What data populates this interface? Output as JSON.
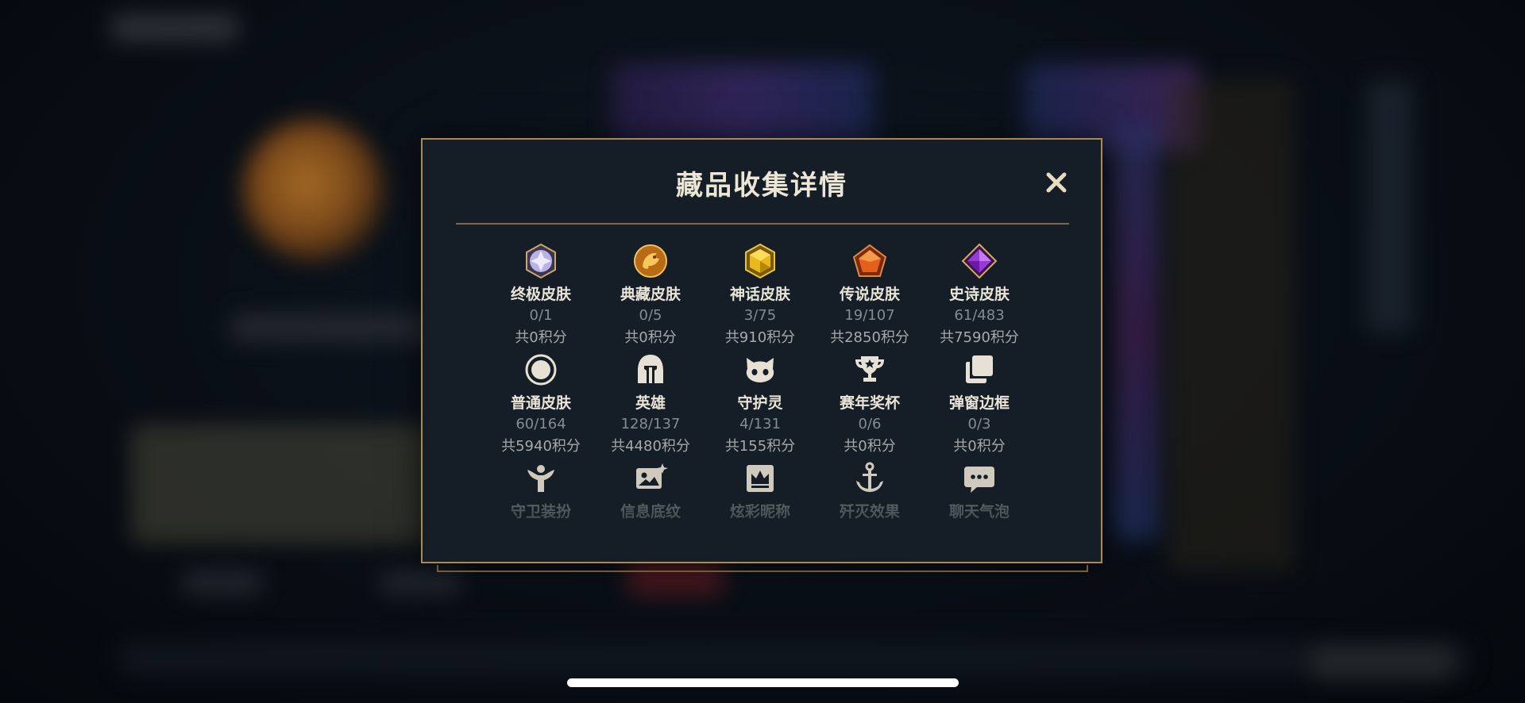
{
  "side_id": "14549520",
  "modal": {
    "title": "藏品收集详情",
    "close_icon": "close-icon"
  },
  "categories": [
    {
      "label": "终极皮肤",
      "count": "0/1",
      "points": "共0积分",
      "icon": "ultimate-skin-icon"
    },
    {
      "label": "典藏皮肤",
      "count": "0/5",
      "points": "共0积分",
      "icon": "collector-skin-icon"
    },
    {
      "label": "神话皮肤",
      "count": "3/75",
      "points": "共910积分",
      "icon": "mythic-skin-icon"
    },
    {
      "label": "传说皮肤",
      "count": "19/107",
      "points": "共2850积分",
      "icon": "legendary-skin-icon"
    },
    {
      "label": "史诗皮肤",
      "count": "61/483",
      "points": "共7590积分",
      "icon": "epic-skin-icon"
    },
    {
      "label": "普通皮肤",
      "count": "60/164",
      "points": "共5940积分",
      "icon": "normal-skin-icon"
    },
    {
      "label": "英雄",
      "count": "128/137",
      "points": "共4480积分",
      "icon": "champion-helmet-icon"
    },
    {
      "label": "守护灵",
      "count": "4/131",
      "points": "共155积分",
      "icon": "little-legend-icon"
    },
    {
      "label": "赛年奖杯",
      "count": "0/6",
      "points": "共0积分",
      "icon": "trophy-icon"
    },
    {
      "label": "弹窗边框",
      "count": "0/3",
      "points": "共0积分",
      "icon": "popup-frame-icon"
    },
    {
      "label": "守卫装扮",
      "icon": "ward-skin-icon"
    },
    {
      "label": "信息底纹",
      "icon": "banner-icon"
    },
    {
      "label": "炫彩昵称",
      "icon": "nickname-crown-icon"
    },
    {
      "label": "歼灭效果",
      "icon": "ace-effect-icon"
    },
    {
      "label": "聊天气泡",
      "icon": "chat-bubble-icon"
    }
  ],
  "colors": {
    "frame_gold": "#a88a52",
    "modal_bg": "#151e26",
    "title_text": "#ece6d6",
    "count_text": "#818c96",
    "points_text": "#a7a9aa"
  }
}
